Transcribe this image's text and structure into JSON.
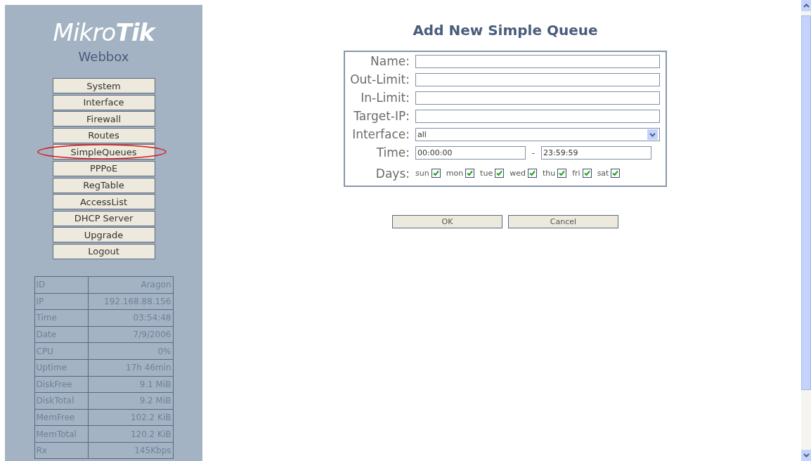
{
  "logo": {
    "brand_light": "Mikro",
    "brand_bold": "Tik",
    "product": "Webbox"
  },
  "menu": [
    {
      "label": "System",
      "highlighted": false
    },
    {
      "label": "Interface",
      "highlighted": false
    },
    {
      "label": "Firewall",
      "highlighted": false
    },
    {
      "label": "Routes",
      "highlighted": false
    },
    {
      "label": "SimpleQueues",
      "highlighted": true
    },
    {
      "label": "PPPoE",
      "highlighted": false
    },
    {
      "label": "RegTable",
      "highlighted": false
    },
    {
      "label": "AccessList",
      "highlighted": false
    },
    {
      "label": "DHCP Server",
      "highlighted": false
    },
    {
      "label": "Upgrade",
      "highlighted": false
    },
    {
      "label": "Logout",
      "highlighted": false
    }
  ],
  "info": [
    {
      "key": "ID",
      "value": "Aragon"
    },
    {
      "key": "IP",
      "value": "192.168.88.156"
    },
    {
      "key": "Time",
      "value": "03:54:48"
    },
    {
      "key": "Date",
      "value": "7/9/2006"
    },
    {
      "key": "CPU",
      "value": "0%"
    },
    {
      "key": "Uptime",
      "value": "17h 46min"
    },
    {
      "key": "DiskFree",
      "value": "9.1 MiB"
    },
    {
      "key": "DiskTotal",
      "value": "9.2 MiB"
    },
    {
      "key": "MemFree",
      "value": "102.2 KiB"
    },
    {
      "key": "MemTotal",
      "value": "120.2 KiB"
    },
    {
      "key": "Rx",
      "value": "145Kbps"
    }
  ],
  "form": {
    "title": "Add New Simple Queue",
    "fields": [
      {
        "label": "Name:",
        "kind": "text"
      },
      {
        "label": "Out-Limit:",
        "kind": "text"
      },
      {
        "label": "In-Limit:",
        "kind": "text"
      },
      {
        "label": "Target-IP:",
        "kind": "text"
      },
      {
        "label": "Interface:",
        "kind": "select",
        "value": "all"
      },
      {
        "label": "Time:",
        "kind": "range",
        "from": "00:00:00",
        "separator": "-",
        "to": "23:59:59"
      },
      {
        "label": "Days:",
        "kind": "days",
        "days": [
          {
            "label": "sun",
            "checked": true
          },
          {
            "label": "mon",
            "checked": true
          },
          {
            "label": "tue",
            "checked": true
          },
          {
            "label": "wed",
            "checked": true
          },
          {
            "label": "thu",
            "checked": true
          },
          {
            "label": "fri",
            "checked": true
          },
          {
            "label": "sat",
            "checked": true
          }
        ]
      }
    ],
    "buttons": [
      "OK",
      "Cancel"
    ]
  }
}
